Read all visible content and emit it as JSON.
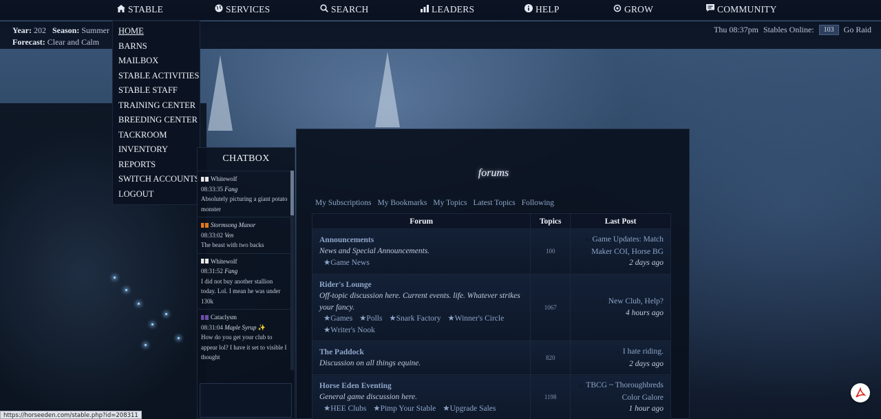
{
  "nav": {
    "items": [
      {
        "label": "STABLE",
        "icon": "home-icon"
      },
      {
        "label": "SERVICES",
        "icon": "globe-icon"
      },
      {
        "label": "SEARCH",
        "icon": "search-icon"
      },
      {
        "label": "LEADERS",
        "icon": "bar-chart-icon"
      },
      {
        "label": "HELP",
        "icon": "info-icon"
      },
      {
        "label": "GROW",
        "icon": "gear-icon"
      },
      {
        "label": "COMMUNITY",
        "icon": "chat-icon"
      }
    ]
  },
  "info": {
    "year_label": "Year:",
    "year_value": "202",
    "season_label": "Season:",
    "season_value": "Summer",
    "currency_char": "$",
    "forecast_label": "Forecast:",
    "forecast_value": "Clear and Calm",
    "time": "Thu 08:37pm",
    "stables_online_label": "Stables Online:",
    "stables_online_count": "103",
    "go_raid": "Go Raid"
  },
  "dropdown": {
    "items": [
      "HOME",
      "BARNS",
      "MAILBOX",
      "STABLE ACTIVITIES",
      "STABLE STAFF",
      "TRAINING CENTER",
      "BREEDING CENTER",
      "TACKROOM",
      "INVENTORY",
      "REPORTS",
      "SWITCH ACCOUNTS",
      "LOGOUT"
    ]
  },
  "chatbox": {
    "title": "CHATBOX",
    "messages": [
      {
        "stable": "Whitewolf",
        "time": "08:33:35",
        "author": "Fang",
        "text": "Absolutely picturing a giant potato monster",
        "badge_color": "#e8e8e8",
        "stable_italic": false
      },
      {
        "stable": "Stormsong Manor",
        "time": "08:33:02",
        "author": "Ven",
        "text": "The beast with two backs",
        "badge_color": "#e07a1a",
        "stable_italic": true
      },
      {
        "stable": "Whitewolf",
        "time": "08:31:52",
        "author": "Fang",
        "text": "I did not buy another stallion today. Lol. I mean he was under 130k",
        "badge_color": "#e8e8e8",
        "stable_italic": false
      },
      {
        "stable": "Cataclysm",
        "time": "08:31:04",
        "author": "Maple Syrup",
        "text": "How do you get your club to appear lol? I have it set to visible I thought",
        "badge_color": "#6a4fa8",
        "stable_italic": false,
        "sparkle": "✨"
      }
    ]
  },
  "forum": {
    "title": "forums",
    "links": [
      "My Subscriptions",
      "My Bookmarks",
      "My Topics",
      "Latest Topics",
      "Following"
    ],
    "headers": {
      "forum": "Forum",
      "topics": "Topics",
      "last_post": "Last Post"
    },
    "rows": [
      {
        "name": "Announcements",
        "desc": "News and Special Announcements.",
        "subs": [
          "★Game News"
        ],
        "topics": "100",
        "last_title": "Game Updates: Match Maker COI, Horse BG",
        "last_time": "2 days ago"
      },
      {
        "name": "Rider's Lounge",
        "desc": "Off-topic discussion here. Current events. life. Whatever strikes your fancy.",
        "subs": [
          "★Games",
          "★Polls",
          "★Snark Factory",
          "★Winner's Circle",
          "★Writer's Nook"
        ],
        "topics": "1067",
        "last_title": "New Club, Help?",
        "last_time": "4 hours ago"
      },
      {
        "name": "The Paddock",
        "desc": "Discussion on all things equine.",
        "subs": [],
        "topics": "820",
        "last_title": "I hate riding.",
        "last_time": "2 days ago"
      },
      {
        "name": "Horse Eden Eventing",
        "desc": "General game discussion here.",
        "subs": [
          "★HEE Clubs",
          "★Pimp Your Stable",
          "★Upgrade Sales"
        ],
        "topics": "1198",
        "last_title": "TBCG ~ Thoroughbreds Color Galore",
        "last_time": "1 hour ago"
      }
    ]
  },
  "status_url": "https://horseeden.com/stable.php?id=208311",
  "colors": {
    "accent": "#8ea6c9",
    "nav_bg": "#0c1424",
    "panel_bg": "#0a111e"
  }
}
